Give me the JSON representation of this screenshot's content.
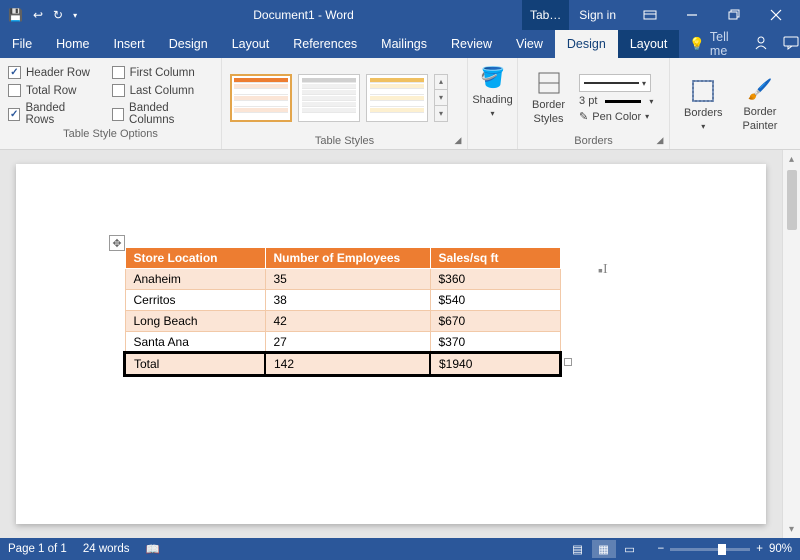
{
  "titlebar": {
    "doc_title": "Document1 - Word",
    "table_tools_label": "Tab…",
    "sign_in": "Sign in"
  },
  "tabs": {
    "file": "File",
    "items": [
      "Home",
      "Insert",
      "Design",
      "Layout",
      "References",
      "Mailings",
      "Review",
      "View"
    ],
    "contextual": {
      "design": "Design",
      "layout": "Layout"
    },
    "tell_me": "Tell me"
  },
  "ribbon": {
    "style_options": {
      "header_row": "Header Row",
      "total_row": "Total Row",
      "banded_rows": "Banded Rows",
      "first_column": "First Column",
      "last_column": "Last Column",
      "banded_columns": "Banded Columns",
      "group_label": "Table Style Options"
    },
    "table_styles_label": "Table Styles",
    "shading": "Shading",
    "border_styles": "Border\nStyles",
    "borders_group_label": "Borders",
    "border_width": "3 pt",
    "pen_color": "Pen Color",
    "borders": "Borders",
    "border_painter": "Border\nPainter"
  },
  "chart_data": {
    "type": "table",
    "headers": [
      "Store Location",
      "Number of Employees",
      "Sales/sq ft"
    ],
    "rows": [
      {
        "store": "Anaheim",
        "employees": "35",
        "sales": "$360"
      },
      {
        "store": "Cerritos",
        "employees": "38",
        "sales": "$540"
      },
      {
        "store": "Long Beach",
        "employees": "42",
        "sales": "$670"
      },
      {
        "store": "Santa Ana",
        "employees": "27",
        "sales": "$370"
      }
    ],
    "total_row": {
      "store": "Total",
      "employees": "142",
      "sales": "$1940"
    }
  },
  "status": {
    "page": "Page 1 of 1",
    "words": "24 words",
    "zoom": "90%"
  }
}
